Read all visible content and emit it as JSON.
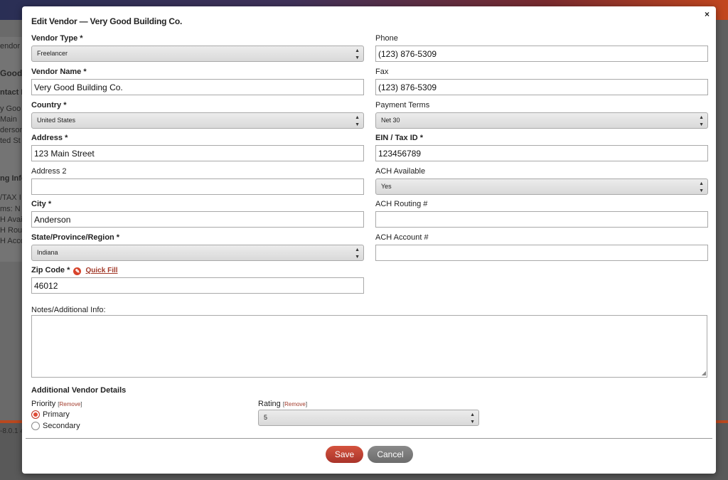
{
  "background": {
    "lines": [
      "endor",
      "Good",
      "ntact In",
      "y Goo",
      "Main",
      "derson",
      "ted St",
      "ng Info",
      "/TAX I",
      "ms: N",
      "H Avail",
      "H Rout",
      "H Acco",
      "-8.0.1 4"
    ]
  },
  "modal": {
    "title": "Edit Vendor — Very Good Building Co.",
    "close": "×"
  },
  "fields": {
    "vendor_type": {
      "label": "Vendor Type *",
      "value": "Freelancer"
    },
    "vendor_name": {
      "label": "Vendor Name *",
      "value": "Very Good Building Co."
    },
    "country": {
      "label": "Country *",
      "value": "United States"
    },
    "address": {
      "label": "Address *",
      "value": "123 Main Street"
    },
    "address2": {
      "label": "Address 2",
      "value": ""
    },
    "city": {
      "label": "City *",
      "value": "Anderson"
    },
    "state": {
      "label": "State/Province/Region *",
      "value": "Indiana"
    },
    "zip": {
      "label": "Zip Code *",
      "value": "46012",
      "quick_fill": "Quick Fill"
    },
    "phone": {
      "label": "Phone",
      "value": "(123) 876-5309"
    },
    "fax": {
      "label": "Fax",
      "value": "(123) 876-5309"
    },
    "payment_terms": {
      "label": "Payment Terms",
      "value": "Net 30"
    },
    "ein": {
      "label": "EIN / Tax ID *",
      "value": "123456789"
    },
    "ach_available": {
      "label": "ACH Available",
      "value": "Yes"
    },
    "ach_routing": {
      "label": "ACH Routing #",
      "value": ""
    },
    "ach_account": {
      "label": "ACH Account #",
      "value": ""
    }
  },
  "notes": {
    "label": "Notes/Additional Info:",
    "value": ""
  },
  "details": {
    "title": "Additional Vendor Details",
    "priority": {
      "label": "Priority",
      "remove": "Remove",
      "options": [
        "Primary",
        "Secondary"
      ],
      "selected": "Primary"
    },
    "rating": {
      "label": "Rating",
      "remove": "Remove",
      "value": "5"
    }
  },
  "buttons": {
    "save": "Save",
    "cancel": "Cancel"
  },
  "colors": {
    "accent": "#c0392b",
    "cancel": "#7a7a7a"
  }
}
